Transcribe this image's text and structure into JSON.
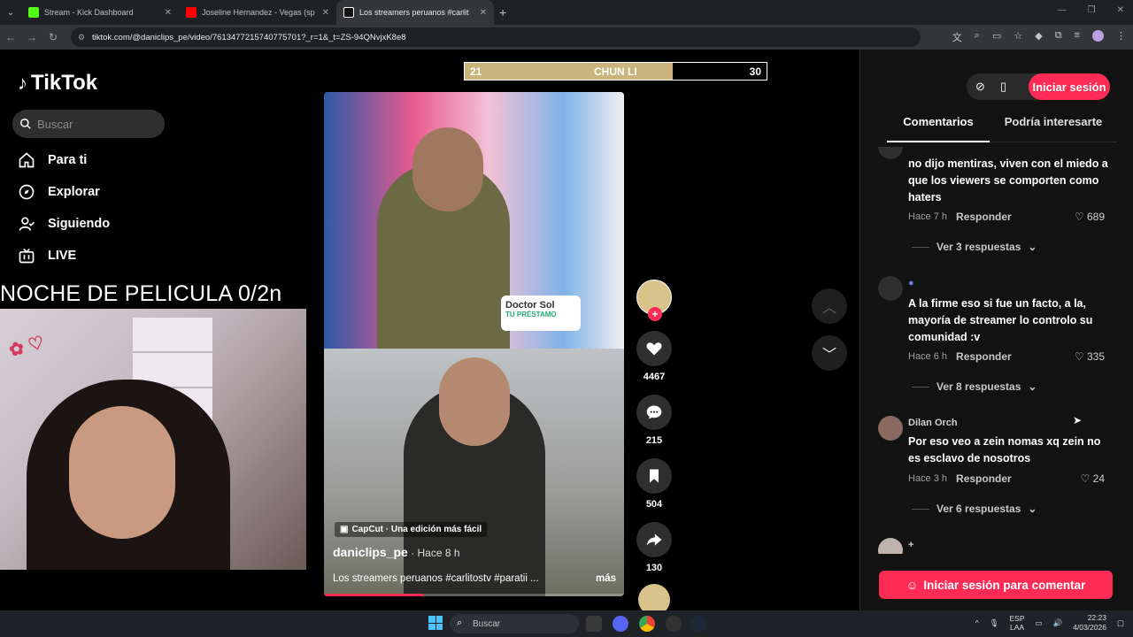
{
  "browser": {
    "tabs": [
      {
        "title": "Stream - Kick Dashboard",
        "color": "#53fc18"
      },
      {
        "title": "Joseline Hernandez - Vegas (sp",
        "color": "#ff0000"
      },
      {
        "title": "Los streamers peruanos #carlit",
        "color": "#ffffff"
      }
    ],
    "url": "tiktok.com/@daniclips_pe/video/7613477215740775701?_r=1&_t=ZS-94QNvjxK8e8"
  },
  "sidebar": {
    "logo": "TikTok",
    "search_placeholder": "Buscar",
    "items": [
      {
        "label": "Para ti",
        "icon": "home-icon"
      },
      {
        "label": "Explorar",
        "icon": "compass-icon"
      },
      {
        "label": "Siguiendo",
        "icon": "user-follow-icon"
      },
      {
        "label": "LIVE",
        "icon": "live-tv-icon"
      }
    ]
  },
  "stream_overlay": {
    "title": "NOCHE DE PELICULA 0/2n",
    "scoreboard": {
      "left": "21",
      "center": "CHUN LI",
      "right": "30",
      "fill_fraction": 0.69
    }
  },
  "video": {
    "capcut": "CapCut · Una edición más fácil",
    "author": "daniclips_pe",
    "time": " · Hace 8 h",
    "description": "Los streamers peruanos #carlitostv #paratii ...",
    "more": "más",
    "progress_fraction": 0.33,
    "sponsor": "Doctor Sol",
    "sponsor_sub": "TU PRÉSTAMO"
  },
  "actions": {
    "likes": "4467",
    "comments": "215",
    "saves": "504",
    "shares": "130"
  },
  "right_panel": {
    "login_button": "Iniciar sesión",
    "tab_comments": "Comentarios",
    "tab_interest": "Podría interesarte",
    "comments": [
      {
        "name": "",
        "text": "no dijo mentiras, viven con el miedo a que los viewers se comporten como haters",
        "time": "Hace 7 h",
        "reply": "Responder",
        "likes": "689",
        "more": "Ver 3 respuestas"
      },
      {
        "name": "",
        "text": "A la firme eso si fue un facto, a la, mayoría de streamer lo controlo su comunidad :v",
        "time": "Hace 6 h",
        "reply": "Responder",
        "likes": "335",
        "more": "Ver 8 respuestas"
      },
      {
        "name": "Dilan Orch",
        "text": "Por eso veo a zein nomas xq zein no es esclavo de nosotros",
        "time": "Hace 3 h",
        "reply": "Responder",
        "likes": "24",
        "more": "Ver 6 respuestas"
      }
    ],
    "login_comment": "Iniciar sesión para comentar"
  },
  "taskbar": {
    "search": "Buscar",
    "lang_top": "ESP",
    "lang_bottom": "LAA",
    "time": "22:23",
    "date": "4/03/2026"
  }
}
